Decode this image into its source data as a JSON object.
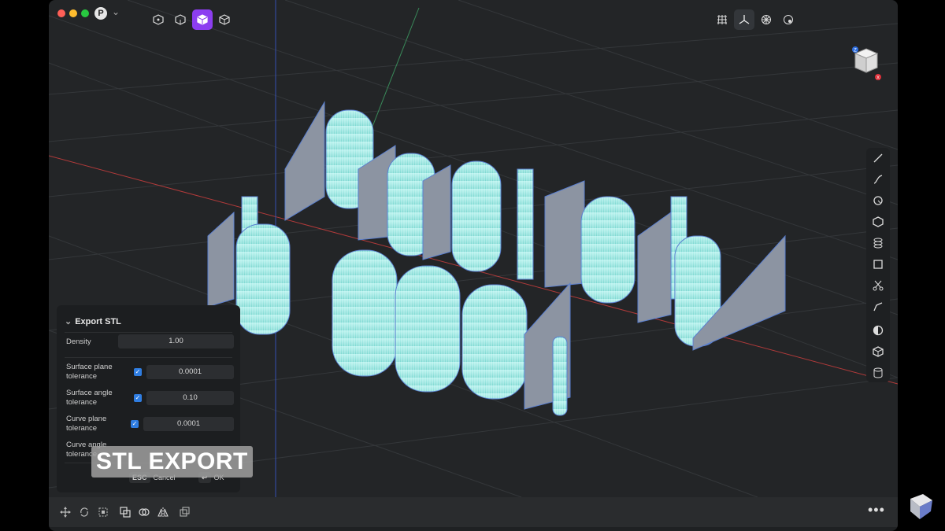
{
  "window": {
    "user_badge": "P",
    "colors": {
      "accent": "#8c3ef0",
      "mesh": "#9fe6e0",
      "axis_x": "#c03a3a",
      "axis_y": "#3a55c0"
    }
  },
  "top_toolbar": {
    "left_tools": [
      "point-icon",
      "solid-icon",
      "mesh-icon",
      "box-icon"
    ],
    "active_index": 2,
    "right_tools": [
      "grid-icon",
      "axes-icon",
      "snap-icon",
      "render-icon"
    ]
  },
  "right_toolbar": [
    "line-icon",
    "curve-icon",
    "arc-icon",
    "polygon-icon",
    "extrude-icon",
    "rectangle-icon",
    "scissors-icon",
    "pen-icon",
    "sphere-icon",
    "cube-icon",
    "cylinder-icon"
  ],
  "export_panel": {
    "title": "Export STL",
    "density_label": "Density",
    "density_value": "1.00",
    "rows": [
      {
        "label": "Surface plane tolerance",
        "checked": true,
        "value": "0.0001"
      },
      {
        "label": "Surface angle tolerance",
        "checked": true,
        "value": "0.10"
      },
      {
        "label": "Curve plane tolerance",
        "checked": true,
        "value": "0.0001"
      },
      {
        "label": "Curve angle tolerance",
        "checked": true,
        "value": ""
      }
    ],
    "cancel_key": "ESC",
    "cancel_label": "Cancel",
    "ok_key": "↩",
    "ok_label": "OK"
  },
  "overlay_caption": "STL EXPORT",
  "bottom_toolbar": {
    "icons": [
      "move-icon",
      "rotate-icon",
      "scale-icon",
      "copy-icon",
      "boolean-icon",
      "mirror-icon",
      "duplicate-icon"
    ],
    "more_label": "•••"
  }
}
